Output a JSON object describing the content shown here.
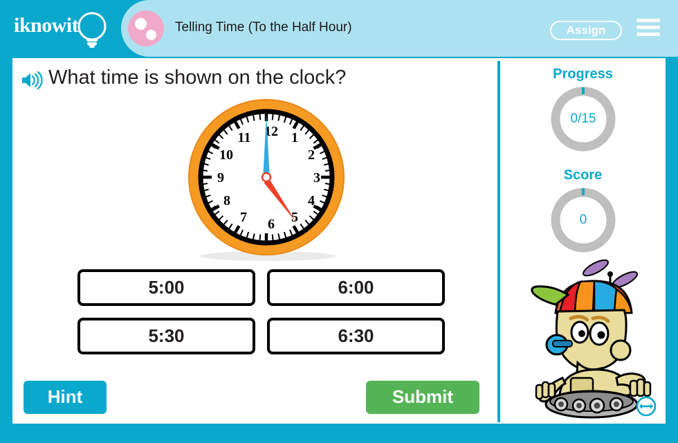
{
  "header": {
    "logo_text": "iknowit",
    "logo_icon": "lightbulb-icon",
    "lesson_icon": "pink-dots-icon",
    "title": "Telling Time (To the Half Hour)",
    "assign_label": "Assign",
    "menu_icon": "hamburger-menu-icon",
    "bg_color": "#0aa8cd",
    "band_color": "#ace2ef",
    "dot_color": "#f0a9cb"
  },
  "question": {
    "audio_icon": "speaker-icon",
    "text": "What time is shown on the clock?"
  },
  "clock": {
    "displayed_time": "5:00",
    "hour_hand_points_to": 5,
    "minute_hand_points_to": 12,
    "hour_hand_color": "#ee4128",
    "minute_hand_color": "#36a9e1",
    "bezel_color": "#f59a23",
    "face_color": "#ffffff",
    "numerals": [
      "12",
      "1",
      "2",
      "3",
      "4",
      "5",
      "6",
      "7",
      "8",
      "9",
      "10",
      "11"
    ]
  },
  "answers": {
    "choices": [
      {
        "label": "5:00"
      },
      {
        "label": "6:00"
      },
      {
        "label": "5:30"
      },
      {
        "label": "6:30"
      }
    ]
  },
  "actions": {
    "hint_label": "Hint",
    "hint_color": "#0aa8cd",
    "submit_label": "Submit",
    "submit_color": "#55b556"
  },
  "sidebar": {
    "progress_label": "Progress",
    "progress_value": "0/15",
    "progress_completed": 0,
    "progress_total": 15,
    "score_label": "Score",
    "score_value": "0",
    "ring_track_color": "#bfbfbf",
    "ring_accent_color": "#0aa8cd",
    "mascot_icon": "robot-mascot-propeller-hat",
    "resize_icon": "resize-horizontal-icon"
  }
}
